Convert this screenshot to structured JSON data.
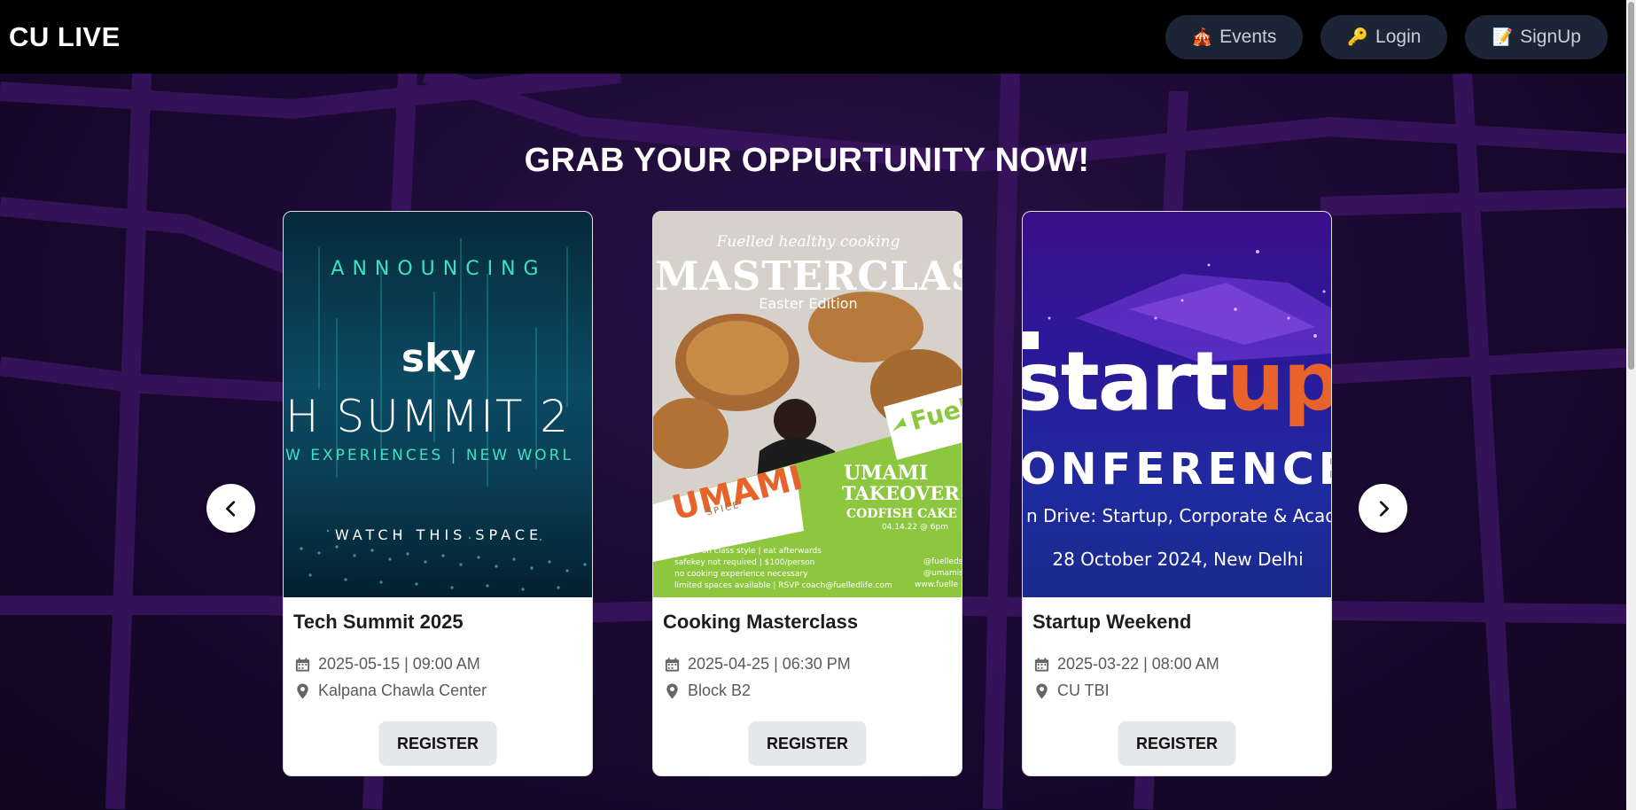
{
  "app": {
    "brand": "CU LIVE"
  },
  "nav": {
    "events": {
      "icon": "🎪",
      "label": "Events"
    },
    "login": {
      "icon": "🔑",
      "label": "Login"
    },
    "signup": {
      "icon": "📝",
      "label": "SignUp"
    }
  },
  "headline": "GRAB YOUR OPPURTUNITY NOW!",
  "events": [
    {
      "title": "Tech Summit 2025",
      "date": "2025-05-15 | 09:00 AM",
      "location": "Kalpana Chawla Center",
      "register": "REGISTER",
      "poster": {
        "line1": "ANNOUNCING",
        "logo": "sky",
        "line2": "H SUMMIT 2",
        "line3": "W EXPERIENCES  |  NEW WORL",
        "line4": "WATCH THIS SPACE"
      }
    },
    {
      "title": "Cooking Masterclass",
      "date": "2025-04-25 | 06:30 PM",
      "location": "Block B2",
      "register": "REGISTER",
      "poster": {
        "script": "Fuelled healthy cooking",
        "headline": "MASTERCLAS",
        "sub": "Easter Edition",
        "brand": "UMAMI",
        "brand_sub": "SPICE",
        "fuel": "Fuel",
        "take1": "UMAMI",
        "take2": "TAKEOVER",
        "take3": "CODFISH CAKE",
        "take4": "04.14.22 @ 6pm",
        "info1": "hands-on class style | eat afterwards",
        "info2": "safekey not required | $100/person",
        "info3": "no cooking experience necessary",
        "info4": "limited spaces available | RSVP coach@fuelledlife.com",
        "h1": "@fuelleds",
        "h2": "@umamis",
        "h3": "www.fuelle"
      }
    },
    {
      "title": "Startup Weekend",
      "date": "2025-03-22 | 08:00 AM",
      "location": "CU TBI",
      "register": "REGISTER",
      "poster": {
        "word_white": "start",
        "word_orange": "up",
        "conf": "ONFERENCE",
        "tag": "n Drive: Startup, Corporate & Acade",
        "date": "28 October 2024, New Delhi"
      }
    }
  ],
  "icons": {
    "events": "circus-tent-icon",
    "login": "key-icon",
    "signup": "memo-icon",
    "date": "calendar-icon",
    "location": "map-pin-icon",
    "prev": "chevron-left-icon",
    "next": "chevron-right-icon"
  },
  "colors": {
    "header": "#000000",
    "nav_button": "#1c2535",
    "background": "#1a0a2e",
    "accent_orange": "#e8632b",
    "accent_green": "#8dc63f"
  }
}
